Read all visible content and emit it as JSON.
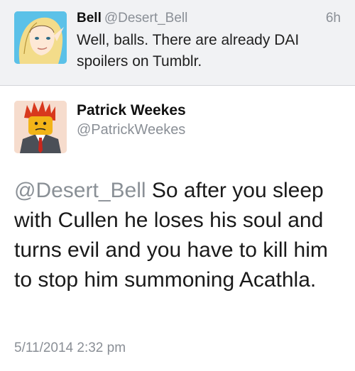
{
  "reply_to": {
    "display_name": "Bell",
    "handle": "@Desert_Bell",
    "time": "6h",
    "text": "Well, balls. There are already DAI spoilers on Tumblr."
  },
  "tweet": {
    "display_name": "Patrick Weekes",
    "handle": "@PatrickWeekes",
    "mention": "@Desert_Bell",
    "text": " So after you sleep with Cullen he loses his soul and turns evil and you have to kill him to stop him summoning Acathla.",
    "timestamp": "5/11/2014 2:32 pm"
  },
  "colors": {
    "reply_background": "#f1f2f4",
    "secondary_text": "#8a8f96",
    "mention_text": "#8a9096"
  }
}
